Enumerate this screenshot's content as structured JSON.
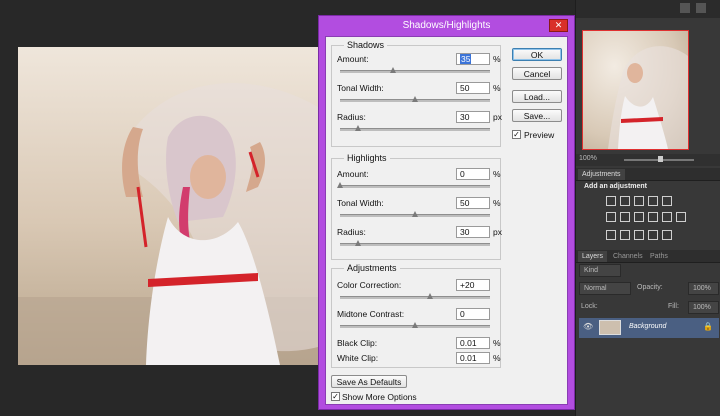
{
  "dialog": {
    "title": "Shadows/Highlights",
    "close_glyph": "✕",
    "buttons": {
      "ok": "OK",
      "cancel": "Cancel",
      "load": "Load...",
      "save": "Save..."
    },
    "preview": {
      "label": "Preview",
      "checked": true
    },
    "shadows": {
      "legend": "Shadows",
      "amount": {
        "label": "Amount:",
        "value": "35",
        "unit": "%",
        "level": 0.35
      },
      "tonal_width": {
        "label": "Tonal Width:",
        "value": "50",
        "unit": "%",
        "level": 0.5
      },
      "radius": {
        "label": "Radius:",
        "value": "30",
        "unit": "px",
        "level": 0.12
      }
    },
    "highlights": {
      "legend": "Highlights",
      "amount": {
        "label": "Amount:",
        "value": "0",
        "unit": "%",
        "level": 0.0
      },
      "tonal_width": {
        "label": "Tonal Width:",
        "value": "50",
        "unit": "%",
        "level": 0.5
      },
      "radius": {
        "label": "Radius:",
        "value": "30",
        "unit": "px",
        "level": 0.12
      }
    },
    "adjustments": {
      "legend": "Adjustments",
      "color_correction": {
        "label": "Color Correction:",
        "value": "+20",
        "level": 0.6
      },
      "midtone_contrast": {
        "label": "Midtone Contrast:",
        "value": "0",
        "level": 0.5
      },
      "black_clip": {
        "label": "Black Clip:",
        "value": "0.01",
        "unit": "%"
      },
      "white_clip": {
        "label": "White Clip:",
        "value": "0.01",
        "unit": "%"
      }
    },
    "save_defaults": "Save As Defaults",
    "more_options": {
      "label": "Show More Options",
      "checked": true
    }
  },
  "panels": {
    "navigator": {
      "zoom": "100%"
    },
    "adjustments": {
      "tab": "Adjustments",
      "heading": "Add an adjustment"
    },
    "layers": {
      "tabs": [
        "Layers",
        "Channels",
        "Paths"
      ],
      "filter_kind": "Kind",
      "blend_mode": "Normal",
      "opacity_label": "Opacity:",
      "opacity": "100%",
      "lock_label": "Lock:",
      "fill_label": "Fill:",
      "fill": "100%",
      "layer_name": "Background"
    }
  },
  "colors": {
    "dialog_frame": "#b24de0",
    "accent_selection": "#3a73d8",
    "layer_selected": "#4a5f82"
  }
}
